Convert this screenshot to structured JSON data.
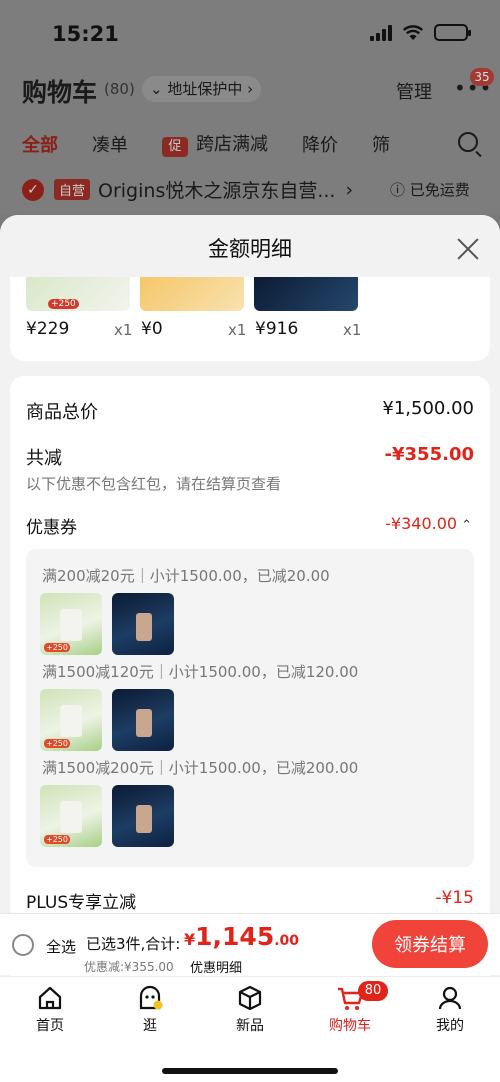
{
  "status": {
    "time": "15:21"
  },
  "background": {
    "title": "购物车",
    "count": "(80)",
    "address": "地址保护中",
    "manage": "管理",
    "more_badge": "35",
    "tabs": [
      "全部",
      "凑单",
      "跨店满减",
      "降价",
      "筛"
    ],
    "promo_tag": "促",
    "shop_badge": "自营",
    "shop_name": "Origins悦木之源京东自营...",
    "free_shipping": "已免运费"
  },
  "modal": {
    "title": "金额明细",
    "products": [
      {
        "price": "¥229",
        "qty": "x1",
        "badge": "+250"
      },
      {
        "price": "¥0",
        "qty": "x1"
      },
      {
        "price": "¥916",
        "qty": "x1"
      }
    ],
    "total_label": "商品总价",
    "total_value": "¥1,500.00",
    "reduce_label": "共减",
    "reduce_value": "-¥355.00",
    "reduce_note": "以下优惠不包含红包，请在结算页查看",
    "coupon_label": "优惠券",
    "coupon_value": "-¥340.00",
    "coupons": [
      "满200减20元｜小计1500.00，已减20.00",
      "满1500减120元｜小计1500.00，已减120.00",
      "满1500减200元｜小计1500.00，已减200.00"
    ],
    "thumb_tag": "+250",
    "plus_label": "PLUS专享立减",
    "plus_value": "-¥15"
  },
  "checkout": {
    "select_all": "全选",
    "selected": "已选3件,合计:",
    "currency": "¥",
    "amount_int": "1,145",
    "amount_dec": ".00",
    "saved": "优惠减:¥355.00",
    "detail_link": "优惠明细",
    "pay_button": "领券结算"
  },
  "nav": {
    "items": [
      "首页",
      "逛",
      "新品",
      "购物车",
      "我的"
    ],
    "cart_badge": "80"
  },
  "colors": {
    "accent": "#e2231a",
    "pay": "#f0433a"
  }
}
